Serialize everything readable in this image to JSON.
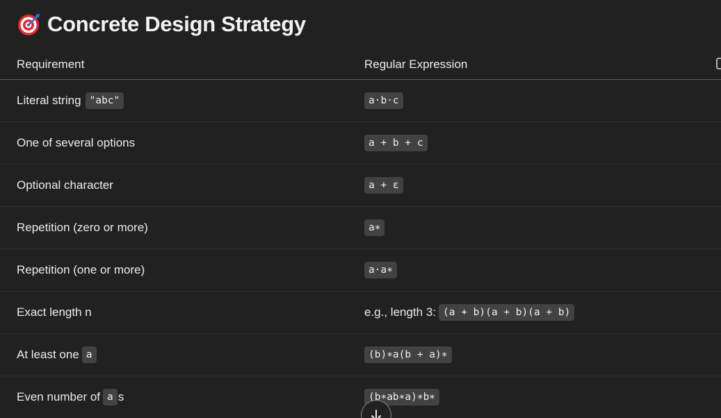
{
  "title": {
    "icon": "target-icon",
    "text": "Concrete Design Strategy"
  },
  "table": {
    "headers": [
      "Requirement",
      "Regular Expression"
    ],
    "rows": [
      {
        "req_text": "Literal string",
        "req_code": "\"abc\"",
        "req_tail": "",
        "re_prefix": "",
        "re_code": "a·b·c"
      },
      {
        "req_text": "One of several options",
        "req_code": "",
        "req_tail": "",
        "re_prefix": "",
        "re_code": "a + b + c"
      },
      {
        "req_text": "Optional character",
        "req_code": "",
        "req_tail": "",
        "re_prefix": "",
        "re_code": "a + ε"
      },
      {
        "req_text": "Repetition (zero or more)",
        "req_code": "",
        "req_tail": "",
        "re_prefix": "",
        "re_code": "a∗"
      },
      {
        "req_text": "Repetition (one or more)",
        "req_code": "",
        "req_tail": "",
        "re_prefix": "",
        "re_code": "a·a∗"
      },
      {
        "req_text": "Exact length n",
        "req_code": "",
        "req_tail": "",
        "re_prefix": "e.g., length 3:",
        "re_code": "(a + b)(a + b)(a + b)"
      },
      {
        "req_text": "At least one",
        "req_code": "a",
        "req_tail": "",
        "re_prefix": "",
        "re_code": "(b)∗a(b + a)∗"
      },
      {
        "req_text": "Even number of",
        "req_code": "a",
        "req_tail": "s",
        "re_prefix": "",
        "re_code": "(b∗ab∗a)∗b∗"
      }
    ]
  },
  "icons": {
    "copy": "copy-icon",
    "scroll_down": "arrow-down-icon"
  },
  "colors": {
    "background": "#212121",
    "code_bg": "#424242",
    "text": "#ececec"
  }
}
